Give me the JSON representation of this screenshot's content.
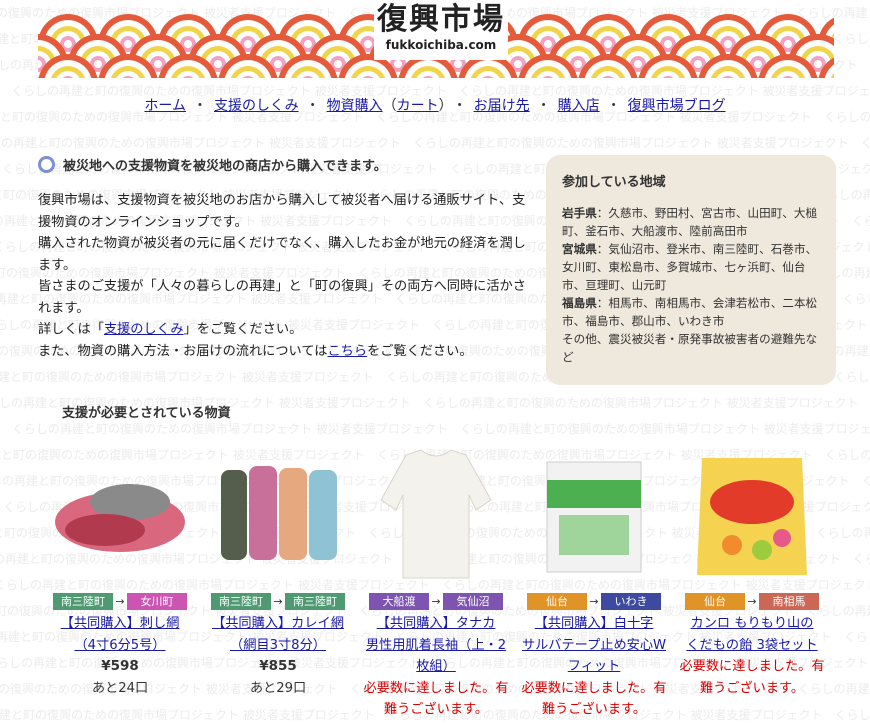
{
  "site": {
    "logo_main": "復興市場",
    "logo_sub": "fukkoichiba.com",
    "bg_text": "くらしの再建と町の復興のための復興市場プロジェクト 被災者支援プロジェクト"
  },
  "nav": {
    "home": "ホーム",
    "how": "支援のしくみ",
    "buy": "物資購入",
    "cart": "カート",
    "dest": "お届け先",
    "shops": "購入店",
    "blog": "復興市場ブログ",
    "sep": "・"
  },
  "main": {
    "lead": "被災地への支援物資を被災地の商店から購入できます。",
    "p1": "復興市場は、支援物資を被災地のお店から購入して被災者へ届ける通販サイト、支援物資のオンラインショップです。",
    "p2": "購入された物資が被災者の元に届くだけでなく、購入したお金が地元の経済を潤します。",
    "p3": "皆さまのご支援が「人々の暮らしの再建」と「町の復興」その両方へ同時に活かされます。",
    "p4_pre": "詳しくは「",
    "p4_link": "支援のしくみ",
    "p4_post": "」をご覧ください。",
    "p5_pre": "また、物資の購入方法・お届けの流れについては",
    "p5_link": "こちら",
    "p5_post": "をご覧ください。"
  },
  "side": {
    "title": "参加している地域",
    "regions": [
      {
        "pref": "岩手県",
        "towns": "：久慈市、野田村、宮古市、山田町、大槌町、釜石市、大船渡市、陸前高田市"
      },
      {
        "pref": "宮城県",
        "towns": "：気仙沼市、登米市、南三陸町、石巻市、女川町、東松島市、多賀城市、七ヶ浜町、仙台市、亘理町、山元町"
      },
      {
        "pref": "福島県",
        "towns": "：相馬市、南相馬市、会津若松市、二本松市、福島市、郡山市、いわき市"
      },
      {
        "pref": "",
        "towns": "その他、震災被災者・原発事故被害者の避難先など"
      }
    ]
  },
  "needs_title": "支援が必要とされている物資",
  "products": [
    {
      "from": "南三陸町",
      "to": "女川町",
      "from_color": "#4f9a72",
      "to_color": "#cc55b4",
      "name1": "【共同購入】刺し網",
      "name2": "（4寸6分5号）",
      "price": "¥598",
      "status": "あと24口",
      "done": false
    },
    {
      "from": "南三陸町",
      "to": "南三陸町",
      "from_color": "#4f9a72",
      "to_color": "#4f9a72",
      "name1": "【共同購入】カレイ網",
      "name2": "（網目3寸8分）",
      "price": "¥855",
      "status": "あと29口",
      "done": false
    },
    {
      "from": "大船渡",
      "to": "気仙沼",
      "from_color": "#7d55b0",
      "to_color": "#7d55b0",
      "name1": "【共同購入】タナカ",
      "name2": "男性用肌着長袖（上・2枚組）",
      "price": "",
      "status": "必要数に達しました。有難うございます。",
      "done": true
    },
    {
      "from": "仙台",
      "to": "いわき",
      "from_color": "#e09428",
      "to_color": "#3d4aa0",
      "name1": "【共同購入】白十字",
      "name2": "サルバテープ止め安心Wフィット",
      "price": "",
      "status": "必要数に達しました。有難うございます。",
      "done": true
    },
    {
      "from": "仙台",
      "to": "南相馬",
      "from_color": "#e09428",
      "to_color": "#cc6655",
      "name1": "カンロ もりもり山の",
      "name2": "くだもの飴 3袋セット",
      "price": "",
      "status": "必要数に達しました。有難うございます。",
      "done": true
    }
  ]
}
